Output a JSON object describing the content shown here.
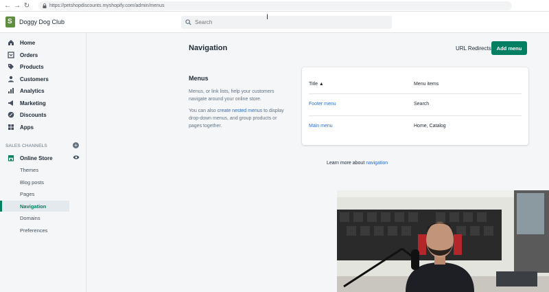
{
  "browser": {
    "url": "https://petshopdiscounts.myshopify.com/admin/menus"
  },
  "topbar": {
    "store_name": "Doggy Dog Club",
    "search_placeholder": "Search"
  },
  "sidebar": {
    "items": [
      {
        "label": "Home",
        "icon": "home-icon"
      },
      {
        "label": "Orders",
        "icon": "orders-icon"
      },
      {
        "label": "Products",
        "icon": "tag-icon"
      },
      {
        "label": "Customers",
        "icon": "person-icon"
      },
      {
        "label": "Analytics",
        "icon": "bar-chart-icon"
      },
      {
        "label": "Marketing",
        "icon": "megaphone-icon"
      },
      {
        "label": "Discounts",
        "icon": "discount-icon"
      },
      {
        "label": "Apps",
        "icon": "apps-icon"
      }
    ],
    "channels_header": "SALES CHANNELS",
    "online_store": "Online Store",
    "sub_items": [
      {
        "label": "Themes",
        "active": false
      },
      {
        "label": "Blog posts",
        "active": false
      },
      {
        "label": "Pages",
        "active": false
      },
      {
        "label": "Navigation",
        "active": true
      },
      {
        "label": "Domains",
        "active": false
      },
      {
        "label": "Preferences",
        "active": false
      }
    ]
  },
  "main": {
    "title": "Navigation",
    "url_redirects_label": "URL Redirects",
    "add_menu_label": "Add menu",
    "menus_heading": "Menus",
    "menus_desc": "Menus, or link lists, help your customers navigate around your online store.",
    "menus_desc2_prefix": "You can also ",
    "menus_desc2_link": "create nested menus",
    "menus_desc2_suffix": " to display drop-down menus, and group products or pages together.",
    "table": {
      "col_title": "Title",
      "col_items": "Menu items",
      "rows": [
        {
          "title": "Footer menu",
          "items": "Search"
        },
        {
          "title": "Main menu",
          "items": "Home, Catalog"
        }
      ]
    },
    "learn_more_prefix": "Learn more about ",
    "learn_more_link": "navigation"
  },
  "colors": {
    "accent": "#008060",
    "link": "#2c6ecb",
    "background": "#f4f6f8"
  }
}
